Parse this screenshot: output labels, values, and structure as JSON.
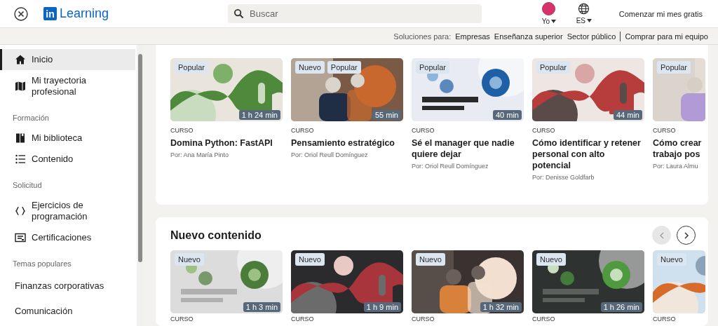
{
  "header": {
    "logo_mark": "in",
    "logo_text": "Learning",
    "search": {
      "placeholder": "Buscar"
    },
    "profile_label": "Yo",
    "language_label": "ES",
    "cta": "Comenzar mi mes gratis"
  },
  "subbar": {
    "prefix": "Soluciones para:",
    "links": [
      "Empresas",
      "Enseñanza superior",
      "Sector público",
      "Comprar para mi equipo"
    ]
  },
  "sidebar": {
    "groups": [
      {
        "items": [
          {
            "kind": "icon-link",
            "label": "Inicio",
            "selected": true
          },
          {
            "kind": "icon-link",
            "label": "Mi trayectoria profesional",
            "selected": false
          }
        ]
      },
      {
        "heading": "Formación",
        "items": [
          {
            "kind": "icon-link",
            "label": "Mi biblioteca",
            "selected": false
          },
          {
            "kind": "icon-link",
            "label": "Contenido",
            "selected": false
          }
        ]
      },
      {
        "heading": "Solicitud",
        "items": [
          {
            "kind": "icon-link",
            "label": "Ejercicios de programación",
            "selected": false
          },
          {
            "kind": "icon-link",
            "label": "Certificaciones",
            "selected": false
          }
        ]
      },
      {
        "heading": "Temas populares",
        "items": [
          {
            "kind": "topic",
            "label": "Finanzas corporativas",
            "selected": false
          },
          {
            "kind": "topic",
            "label": "Comunicación",
            "selected": false
          }
        ]
      }
    ]
  },
  "sections": [
    {
      "courses": [
        {
          "badges": [
            "Popular"
          ],
          "duration": "1 h 24 min",
          "type": "CURSO",
          "title": "Domina Python: FastAPI",
          "author": "Por: Ana María Pinto"
        },
        {
          "badges": [
            "Nuevo",
            "Popular"
          ],
          "duration": "55 min",
          "type": "CURSO",
          "title": "Pensamiento estratégico",
          "author": "Por: Oriol Reull Domínguez"
        },
        {
          "badges": [
            "Popular"
          ],
          "duration": "40 min",
          "type": "CURSO",
          "title": "Sé el manager que nadie quiere dejar",
          "author": "Por: Oriol Reull Domínguez"
        },
        {
          "badges": [
            "Popular"
          ],
          "duration": "44 min",
          "type": "CURSO",
          "title": "Cómo identificar y retener personal con alto potencial",
          "author": "Por: Denisse Goldfarb"
        },
        {
          "badges": [
            "Popular"
          ],
          "type": "CURSO",
          "title": "Cómo crear trabajo pos",
          "author": "Por: Laura Almu"
        }
      ]
    },
    {
      "title": "Nuevo contenido",
      "prev": {
        "disabled": true
      },
      "next": {
        "disabled": false
      },
      "courses": [
        {
          "badges": [
            "Nuevo"
          ],
          "duration": "1 h 3 min",
          "type": "CURSO"
        },
        {
          "badges": [
            "Nuevo"
          ],
          "duration": "1 h 9 min",
          "type": "CURSO"
        },
        {
          "badges": [
            "Nuevo"
          ],
          "duration": "1 h 32 min",
          "type": "CURSO"
        },
        {
          "badges": [
            "Nuevo"
          ],
          "duration": "1 h 26 min",
          "type": "CURSO"
        },
        {
          "badges": [
            "Nuevo"
          ],
          "type": "CURSO"
        }
      ]
    }
  ]
}
